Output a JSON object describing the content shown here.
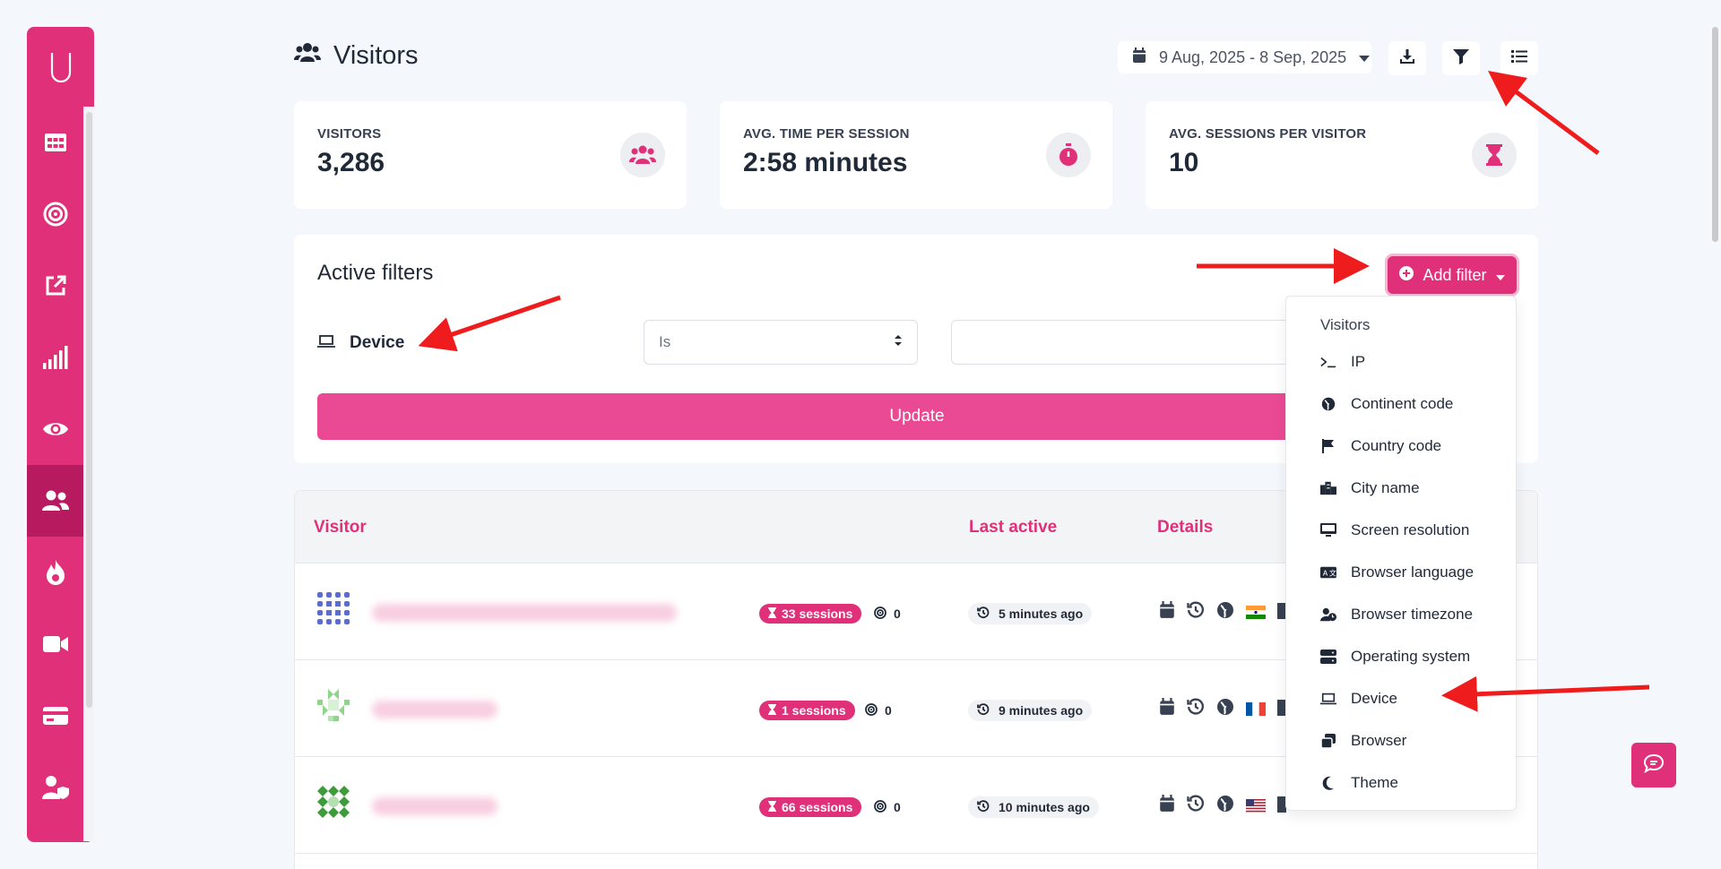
{
  "header": {
    "title": "Visitors",
    "date_range": "9 Aug, 2025 - 8 Sep, 2025"
  },
  "stats": [
    {
      "label": "VISITORS",
      "value": "3,286",
      "icon": "users-icon"
    },
    {
      "label": "AVG. TIME PER SESSION",
      "value": "2:58 minutes",
      "icon": "stopwatch-icon"
    },
    {
      "label": "AVG. SESSIONS PER VISITOR",
      "value": "10",
      "icon": "hourglass-icon"
    }
  ],
  "filters": {
    "title": "Active filters",
    "add_filter_label": "Add filter",
    "device_label": "Device",
    "operator_value": "Is",
    "value_input": "",
    "update_label": "Update"
  },
  "table": {
    "headers": {
      "visitor": "Visitor",
      "last_active": "Last active",
      "details": "Details"
    },
    "rows": [
      {
        "sessions": "33 sessions",
        "goals": "0",
        "last_active": "5 minutes ago",
        "flag": "India"
      },
      {
        "sessions": "1 sessions",
        "goals": "0",
        "last_active": "9 minutes ago",
        "flag": "France"
      },
      {
        "sessions": "66 sessions",
        "goals": "0",
        "last_active": "10 minutes ago",
        "flag": "United States"
      }
    ]
  },
  "dropdown": {
    "header": "Visitors",
    "items": [
      {
        "label": "IP",
        "icon": "terminal-icon"
      },
      {
        "label": "Continent code",
        "icon": "globe-icon"
      },
      {
        "label": "Country code",
        "icon": "flag-icon"
      },
      {
        "label": "City name",
        "icon": "city-icon"
      },
      {
        "label": "Screen resolution",
        "icon": "monitor-icon"
      },
      {
        "label": "Browser language",
        "icon": "language-icon"
      },
      {
        "label": "Browser timezone",
        "icon": "user-clock-icon"
      },
      {
        "label": "Operating system",
        "icon": "server-icon"
      },
      {
        "label": "Device",
        "icon": "laptop-icon"
      },
      {
        "label": "Browser",
        "icon": "windows-icon"
      },
      {
        "label": "Theme",
        "icon": "moon-icon"
      }
    ]
  },
  "colors": {
    "brand": "#e0307a",
    "brand_dark": "#b71a5f",
    "update": "#ea4a94",
    "annotation": "#ee1c1c"
  }
}
